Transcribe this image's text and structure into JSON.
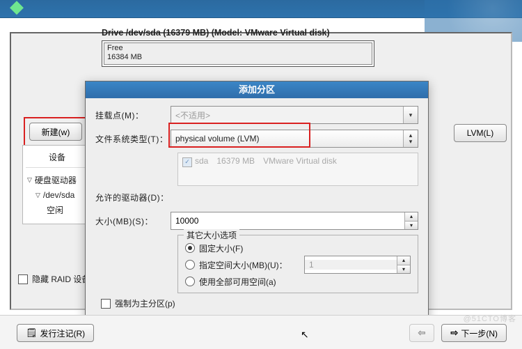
{
  "drive": {
    "title": "Drive /dev/sda (16379 MB) (Model: VMware Virtual disk)",
    "free_label": "Free",
    "free_size": "16384 MB"
  },
  "dialog": {
    "title": "添加分区",
    "mount_label": "挂载点(M)：",
    "mount_value": "<不适用>",
    "fstype_label": "文件系统类型(T)：",
    "fstype_value": "physical volume (LVM)",
    "allowdrv_label": "允许的驱动器(D)：",
    "drv_name": "sda",
    "drv_size": "16379 MB",
    "drv_model": "VMware Virtual disk",
    "size_label": "大小(MB)(S)：",
    "size_value": "10000",
    "group_title": "其它大小选项",
    "opt_fixed": "固定大小(F)",
    "opt_fill_label": "指定空间大小(MB)(U)：",
    "opt_fill_value": "1",
    "opt_all": "使用全部可用空间(a)",
    "force_primary": "强制为主分区(p)"
  },
  "sidebar": {
    "header": "设备",
    "items": [
      "硬盘驱动器",
      "/dev/sda",
      "空闲"
    ]
  },
  "buttons": {
    "new": "新建(w)",
    "lvm": "LVM(L)",
    "release": "发行注记(R)",
    "back": "返回",
    "next": "下一步(N)"
  },
  "hide_raid": "隐藏 RAID 设备/L",
  "watermark": "@51CTO博客"
}
